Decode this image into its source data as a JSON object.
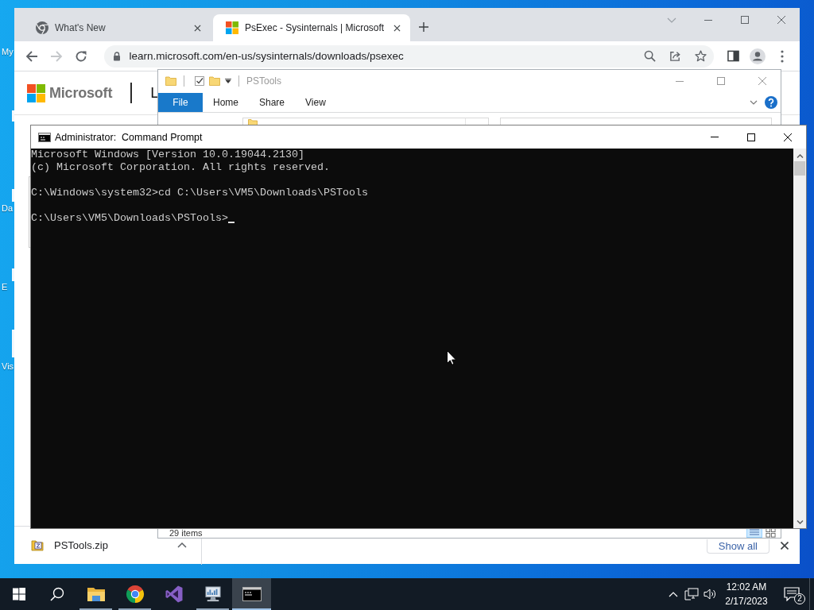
{
  "desktop": {
    "icons": [
      {
        "label": "My"
      },
      {
        "label": "Da"
      },
      {
        "label": "E"
      },
      {
        "label": "Vis"
      }
    ]
  },
  "browser": {
    "tabs": [
      {
        "kind": "internal",
        "title": "What's New",
        "selected": false
      },
      {
        "kind": "site",
        "title": "PsExec - Sysinternals | Microsoft",
        "selected": true
      }
    ],
    "nav_buttons": [
      {
        "kind": "back",
        "disabled": false
      },
      {
        "kind": "forward",
        "disabled": true
      },
      {
        "kind": "reload",
        "disabled": false
      }
    ],
    "address": "learn.microsoft.com/en-us/sysinternals/downloads/psexec",
    "page": {
      "brand": "Microsoft",
      "nav_item": "L"
    },
    "downloads": {
      "items": [
        {
          "name": "PSTools.zip"
        }
      ],
      "show_all": "Show all"
    }
  },
  "explorer": {
    "title": "PSTools",
    "active": false,
    "ribbon_tabs": [
      {
        "kind": "menu",
        "label": "File"
      },
      {
        "kind": "tab",
        "label": "Home"
      },
      {
        "kind": "tab",
        "label": "Share"
      },
      {
        "kind": "tab",
        "label": "View"
      }
    ],
    "status": "29 items"
  },
  "console": {
    "title": "Administrator:  Command Prompt",
    "blocks": [
      [
        "Microsoft Windows [Version 10.0.19044.2130]",
        "(c) Microsoft Corporation. All rights reserved."
      ],
      [
        "C:\\Windows\\system32>cd C:\\Users\\VM5\\Downloads\\PSTools"
      ],
      [
        "C:\\Users\\VM5\\Downloads\\PSTools>"
      ]
    ],
    "cursor": true
  },
  "taskbar": {
    "apps": [
      {
        "kind": "folder",
        "running": true,
        "selected": false
      },
      {
        "kind": "browser",
        "running": true,
        "selected": false
      },
      {
        "kind": "studio",
        "running": false,
        "selected": false
      },
      {
        "kind": "monitor",
        "running": true,
        "selected": false
      },
      {
        "kind": "console",
        "running": true,
        "selected": true
      }
    ],
    "clock": {
      "time": "12:02 AM",
      "date": "2/17/2023"
    },
    "notification_count": "2"
  }
}
